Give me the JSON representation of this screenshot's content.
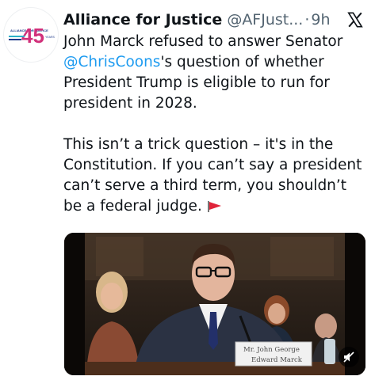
{
  "tweet": {
    "author_name": "Alliance for Justice",
    "handle": "@AFJust...",
    "separator": "·",
    "time": "9h",
    "avatar": {
      "small_text_top": "ALLIANCE FOR JUSTICE",
      "number": "45",
      "small_text_right": "YEARS",
      "colors": [
        "#1f3a8a",
        "#d1307a",
        "#2bb0c8"
      ]
    },
    "paragraph1": {
      "before_mention": "John Marck refused to answer Senator ",
      "mention": "@ChrisCoons",
      "after_mention": "'s question of whether President Trump is eligible to run for president in 2028."
    },
    "paragraph2": "This isn’t a trick question – it's in the Constitution. If you can’t say a president can’t serve a third term, you shouldn’t be a federal judge.",
    "flag_emoji": "triangular-flag-icon",
    "media": {
      "type": "video",
      "placard_line1": "Mr. John George",
      "placard_line2": "Edward Marck",
      "mute_icon": "speaker-muted-icon"
    },
    "close_icon": "x-logo-icon",
    "accent_color": "#1d9bf0"
  }
}
